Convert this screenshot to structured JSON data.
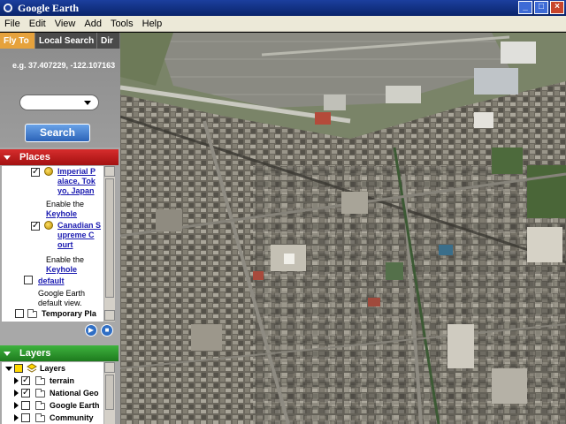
{
  "window": {
    "title": "Google Earth"
  },
  "menu": [
    "File",
    "Edit",
    "View",
    "Add",
    "Tools",
    "Help"
  ],
  "tabs": [
    "Fly To",
    "Local Search",
    "Dir"
  ],
  "fly_to": {
    "coords_hint": "e.g. 37.407229, -122.107163",
    "search_label": "Search"
  },
  "places": {
    "header": "Places",
    "items": [
      {
        "label": "Imperial P alace, Tok yo, Japan",
        "lines": [
          "Imperial P",
          "alace, Tok",
          "yo, Japan"
        ],
        "checked": true
      },
      {
        "note_prefix": "Enable the",
        "link": "Keyhole"
      },
      {
        "label": "Canadian S upreme C ourt",
        "lines": [
          "Canadian S",
          "upreme C",
          "ourt"
        ],
        "checked": true
      },
      {
        "note_prefix": "Enable the",
        "link": "Keyhole"
      },
      {
        "label": "default",
        "checked": false
      },
      {
        "desc_lines": [
          "Google Earth",
          "default view."
        ]
      },
      {
        "label": "Temporary Pla",
        "checked": false
      }
    ]
  },
  "layers": {
    "header": "Layers",
    "items": [
      {
        "label": "Layers"
      },
      {
        "label": "terrain",
        "checked": true
      },
      {
        "label": "National Geo",
        "checked": true
      },
      {
        "label": "Google Earth",
        "checked": false
      },
      {
        "label": "Community",
        "checked": false
      }
    ]
  },
  "colors": {
    "places_header": "#c21b1b",
    "layers_header": "#2a9a2a",
    "active_tab": "#e6a23c",
    "search_button": "#3b78cc"
  }
}
